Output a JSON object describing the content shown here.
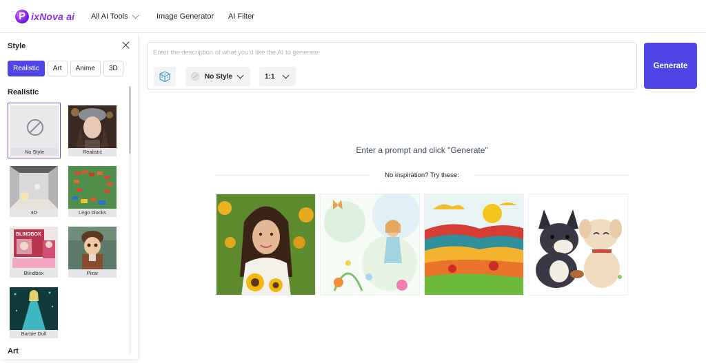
{
  "header": {
    "logo_text": "ixNova ai",
    "nav": [
      {
        "label": "All AI Tools"
      },
      {
        "label": "Image Generator"
      },
      {
        "label": "AI Filter"
      }
    ]
  },
  "sidebar": {
    "title": "Style",
    "chips": [
      "Realistic",
      "Art",
      "Anime",
      "3D"
    ],
    "active_chip": "Realistic",
    "section_title": "Realistic",
    "next_section_title": "Art",
    "tiles": [
      {
        "label": "No Style",
        "selected": true
      },
      {
        "label": "Realistic"
      },
      {
        "label": "3D"
      },
      {
        "label": "Lego blocks"
      },
      {
        "label": "Blindbox"
      },
      {
        "label": "Pixar"
      },
      {
        "label": "Barbie Doll"
      }
    ]
  },
  "prompt": {
    "placeholder": "Enter the description of what you'd like the AI to generate",
    "value": "",
    "style_label": "No Style",
    "ratio_label": "1:1",
    "generate_label": "Generate"
  },
  "empty_state": {
    "title": "Enter a prompt and click \"Generate\"",
    "inspiration": "No inspiration? Try these:"
  },
  "colors": {
    "accent": "#5046e5",
    "logo": "#8c2ee6"
  }
}
